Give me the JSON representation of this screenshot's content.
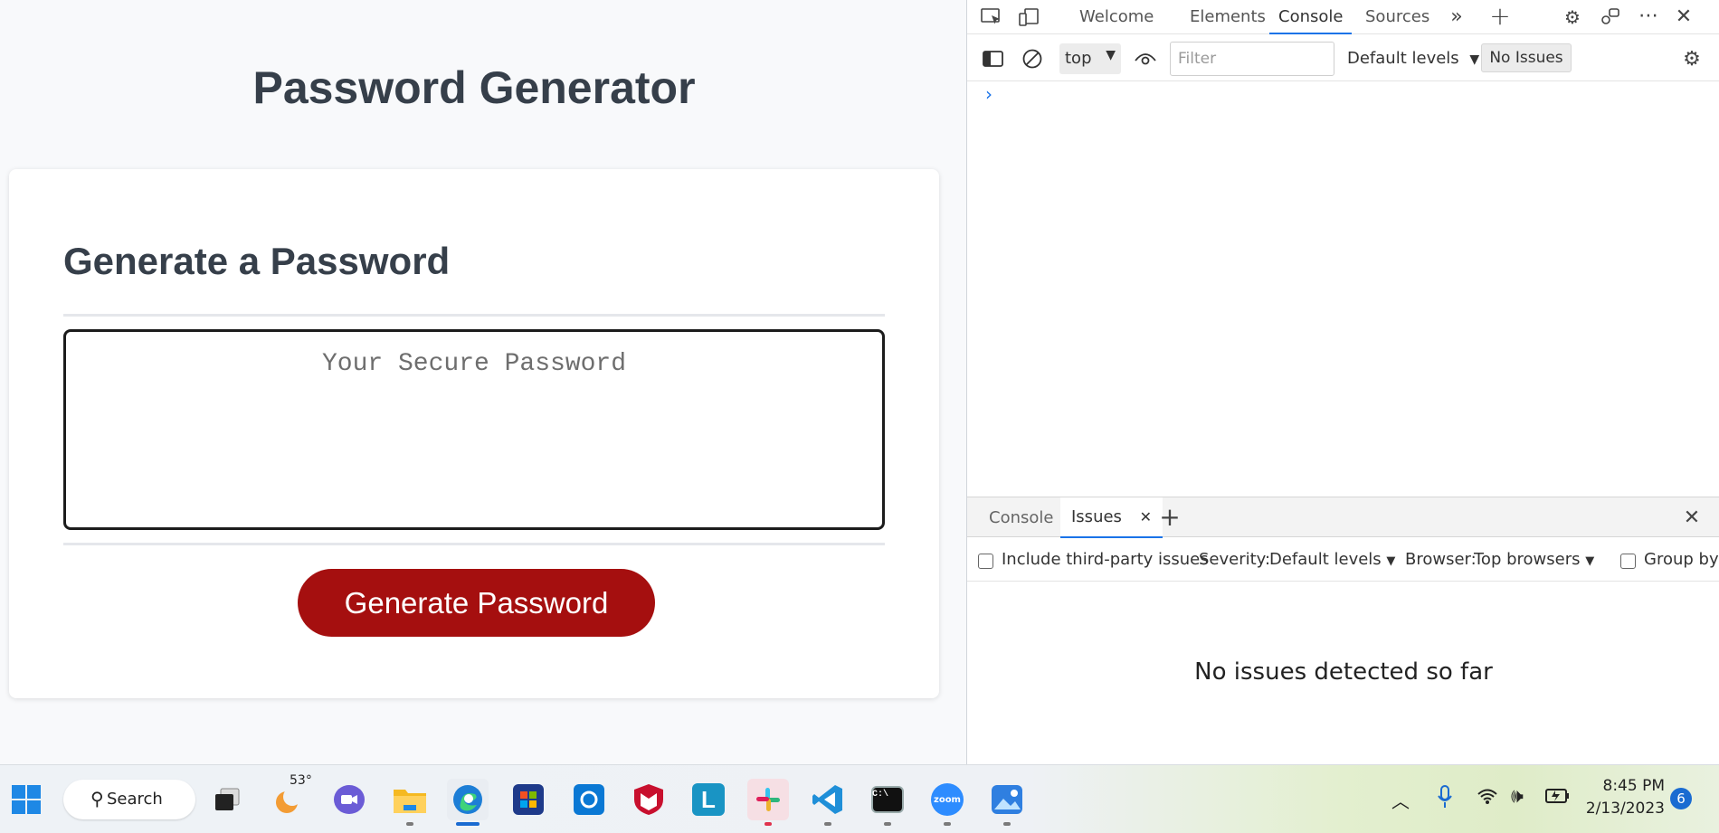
{
  "app": {
    "title": "Password Generator",
    "card_title": "Generate a Password",
    "password_placeholder": "Your Secure Password",
    "password_value": "",
    "generate_button": "Generate Password"
  },
  "devtools": {
    "tabs": [
      "Welcome",
      "Elements",
      "Console",
      "Sources"
    ],
    "active_tab": "Console",
    "toolbar": {
      "context": "top",
      "filter_placeholder": "Filter",
      "levels": "Default levels",
      "issues_button": "No Issues"
    },
    "prompt_symbol": "›",
    "drawer": {
      "tabs": [
        "Console",
        "Issues"
      ],
      "active_tab": "Issues",
      "include_third_party": "Include third-party issues",
      "severity_label": "Severity:",
      "severity_value": "Default levels",
      "browser_label": "Browser:",
      "browser_value": "Top browsers",
      "group_by": "Group by",
      "empty_message": "No issues detected so far"
    }
  },
  "taskbar": {
    "search_label": "Search",
    "weather_temp": "53°",
    "time": "8:45 PM",
    "date": "2/13/2023",
    "notification_count": "6",
    "colors": {
      "accent": "#1a73e8",
      "button": "#a50f0f"
    }
  }
}
